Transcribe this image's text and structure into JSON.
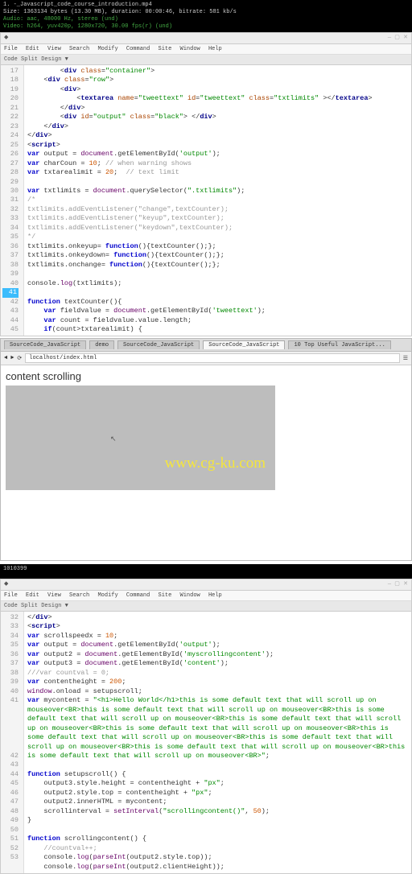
{
  "terminal": {
    "line1": "1. -_Javascript_code_course_introduction.mp4",
    "line2": "Size: 1363134 bytes (13.30 MB), duration: 00:00:46, bitrate: 581 kb/s",
    "line3": "Audio: aac, 48000 Hz, stereo (und)",
    "line4": "Video: h264, yuv420p, 1280x720, 30.00 fps(r) (und)"
  },
  "editor1": {
    "menu": [
      "File",
      "Edit",
      "View",
      "Search",
      "Modify",
      "Command",
      "Site",
      "Window",
      "Help"
    ],
    "tabs": "Code  Split  Design  ▼",
    "lines": {
      "17": "        <div class=\"container\">",
      "18": "    <div class=\"row\">",
      "19": "        <div>",
      "20": "            <textarea name=\"tweettext\" id=\"tweettext\" class=\"txtlimits\" ></textarea>",
      "21": "        </div>",
      "22": "        <div id=\"output\" class=\"black\"> </div>",
      "23": "    </div>",
      "24": "</div>",
      "25": "<script>",
      "26": "var output = document.getElementById('output');",
      "27": "var charCoun = 10; // when warning shows",
      "28": "var txtarealimit = 20;  // text limit",
      "29": "",
      "30": "var txtlimits = document.querySelector(\".txtlimits\");",
      "31": "/*",
      "32": "txtlimits.addEventListener(\"change\",textCounter);",
      "33": "txtlimits.addEventListener(\"keyup\",textCounter);",
      "34": "txtlimits.addEventListener(\"keydown\",textCounter);",
      "35": "*/",
      "36": "txtlimits.onkeyup= function(){textCounter();};",
      "37": "txtlimits.onkeydown= function(){textCounter();};",
      "38": "txtlimits.onchange= function(){textCounter();};",
      "39": "",
      "40": "console.log(txtlimits);",
      "41": "",
      "42": "function textCounter(){",
      "43": "    var fieldvalue = document.getElementById('tweettext');",
      "44": "    var count = fieldvalue.value.length;",
      "45": "    if(count>txtarealimit) {"
    }
  },
  "browser": {
    "tabs": [
      "SourceCode_JavaScript",
      "demo",
      "SourceCode_JavaScript",
      "SourceCode_JavaScript",
      "10 Top Useful JavaScript..."
    ],
    "url": "localhost/index.html",
    "title": "content scrolling",
    "watermark": "www.cg-ku.com"
  },
  "terminal2": {
    "line": "1010399"
  },
  "editor2": {
    "menu": [
      "File",
      "Edit",
      "View",
      "Search",
      "Modify",
      "Command",
      "Site",
      "Window",
      "Help"
    ],
    "tabs": "Code  Split  Design  ▼",
    "lines": {
      "32": "</div>",
      "33": "<script>",
      "34": "var scrollspeedx = 10;",
      "35": "var output = document.getElementById('output');",
      "36": "var output2 = document.getElementById('myscrollingcontent');",
      "37": "var output3 = document.getElementById('content');",
      "38": "///var countval = 0;",
      "39": "var contentheight = 200;",
      "40": "window.onload = setupscroll;",
      "41": "var mycontent = \"<h1>Hello World</h1>this is some default text that will scroll up on mouseover<BR>this is some default text that will scroll up on mouseover<BR>this is some default text that will scroll up on mouseover<BR>this is some default text that will scroll up on mouseover<BR>this is some default text that will scroll up on mouseover<BR>this is some default text that will scroll up on mouseover<BR>this is some default text that will scroll up on mouseover<BR>this is some default text that will scroll up on mouseover<BR>this is some default text that will scroll up on mouseover<BR>\";",
      "42": "",
      "43": "function setupscroll() {",
      "44": "    output3.style.height = contentheight + \"px\";",
      "45": "    output2.style.top = contentheight + \"px\";",
      "46": "    output2.innerHTML = mycontent;",
      "47": "    scrollinterval = setInterval(\"scrollingcontent()\", 50);",
      "48": "}",
      "49": "",
      "50": "function scrollingcontent() {",
      "51": "    //countval++;",
      "52": "    console.log(parseInt(output2.style.top));",
      "53": "    console.log(parseInt(output2.clientHeight));"
    }
  },
  "chart_data": null
}
